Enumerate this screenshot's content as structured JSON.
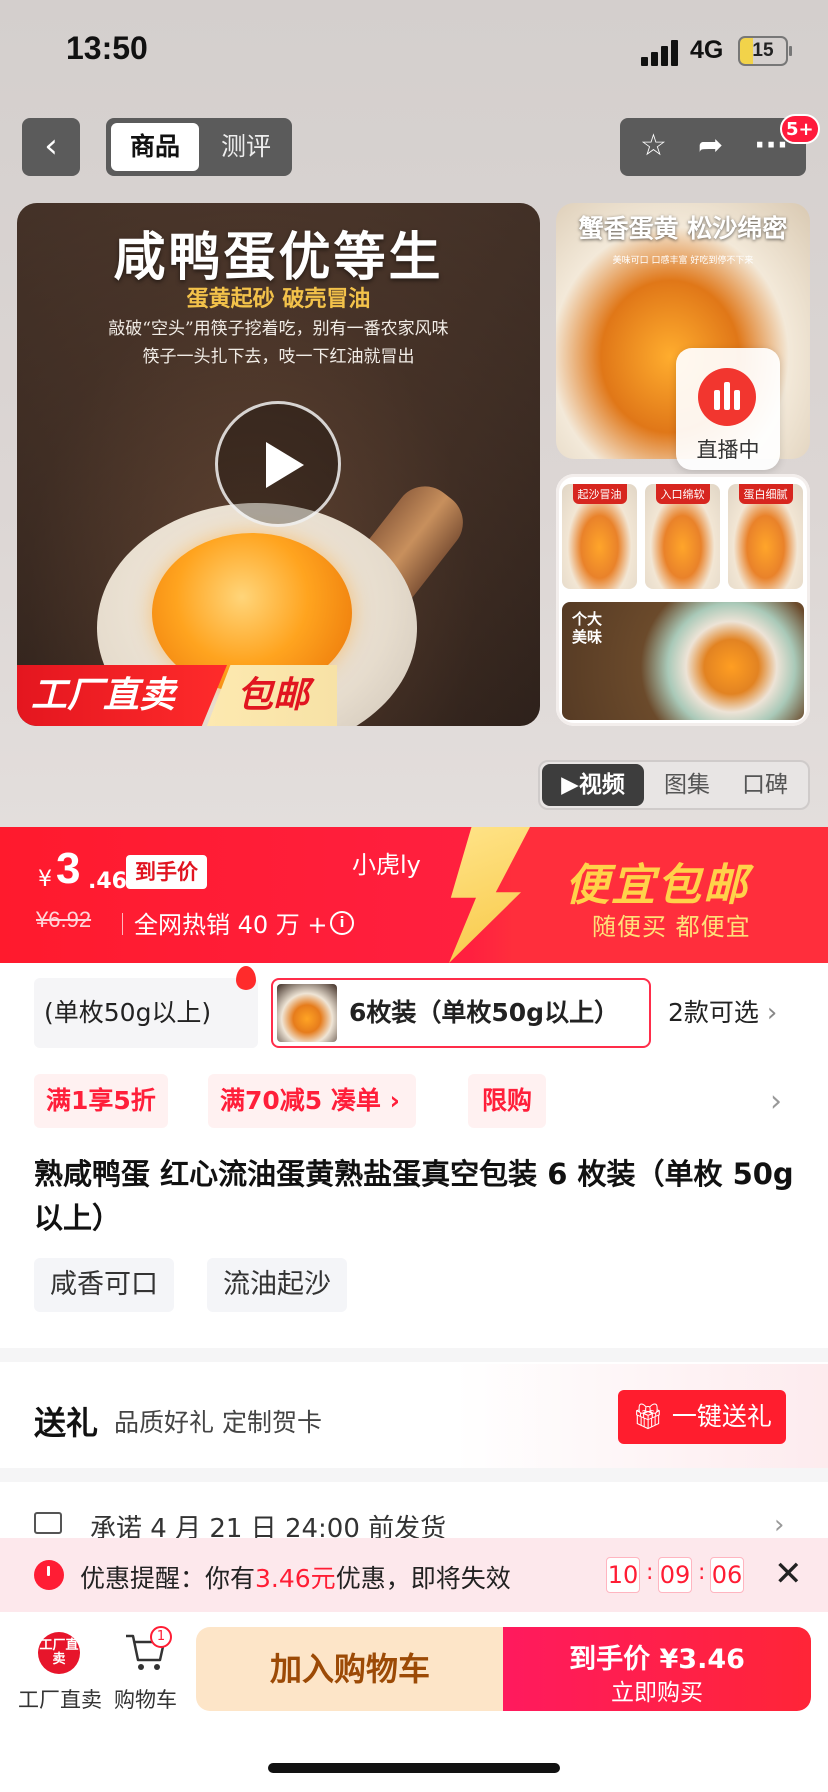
{
  "status": {
    "time": "13:50",
    "network": "4G",
    "battery": "15"
  },
  "nav": {
    "tab_product": "商品",
    "tab_review": "测评",
    "badge": "5+"
  },
  "hero": {
    "title": "咸鸭蛋优等生",
    "subtitle": "蛋黄起砂 破壳冒油",
    "desc1": "敲破“空头”用筷子挖着吃，别有一番农家风味",
    "desc2": "筷子一头扎下去，吱一下红油就冒出",
    "tag_factory": "工厂直卖",
    "tag_freeship": "包邮"
  },
  "thumb1": {
    "title": "蟹香蛋黄 松沙绵密",
    "small": "美味可口 口感丰富 好吃到停不下来"
  },
  "live": {
    "label": "直播中"
  },
  "thumb2": {
    "tags": [
      "起沙冒油",
      "入口绵软",
      "蛋白细腻"
    ],
    "big_label": "个大美味"
  },
  "media_tabs": [
    "▶视频",
    "图集",
    "口碑"
  ],
  "promo": {
    "yen": "¥",
    "price_int": "3",
    "price_dec": ".46",
    "final_tag": "到手价",
    "nick": "小虎ly",
    "original": "¥6.92",
    "hot": "全网热销 40 万 +",
    "banner_title": "便宜包邮",
    "banner_sub": "随便买 都便宜"
  },
  "sku": {
    "option1": "(单枚50g以上)",
    "option2": "6枚装（单枚50g以上）",
    "more": "2款可选"
  },
  "coupons": [
    "满1享5折",
    "满70减5  凑单 ›",
    "限购"
  ],
  "product_title": "熟咸鸭蛋 红心流油蛋黄熟盐蛋真空包装 6 枚装（单枚 50g 以上）",
  "features": [
    "咸香可口",
    "流油起沙"
  ],
  "gift": {
    "title": "送礼",
    "subtitle": "品质好礼 定制贺卡",
    "button": "一键送礼"
  },
  "shipping": {
    "text": "承诺 4 月 21 日 24:00 前发货"
  },
  "reminder": {
    "prefix": "优惠提醒：你有",
    "amount": "3.46元",
    "suffix": "优惠，即将失效",
    "hh": "10",
    "mm": "09",
    "ss": "06"
  },
  "bottom": {
    "shop_icon_text": "工厂直卖",
    "shop_label": "工厂直卖",
    "cart_label": "购物车",
    "cart_count": "1",
    "add_cart": "加入购物车",
    "buy_line1": "到手价 ¥3.46",
    "buy_line2": "立即购买"
  },
  "colors": {
    "brand_red": "#ff1d2e",
    "banner_gold": "#ffd24a",
    "cart_bg": "#fde5c8"
  }
}
